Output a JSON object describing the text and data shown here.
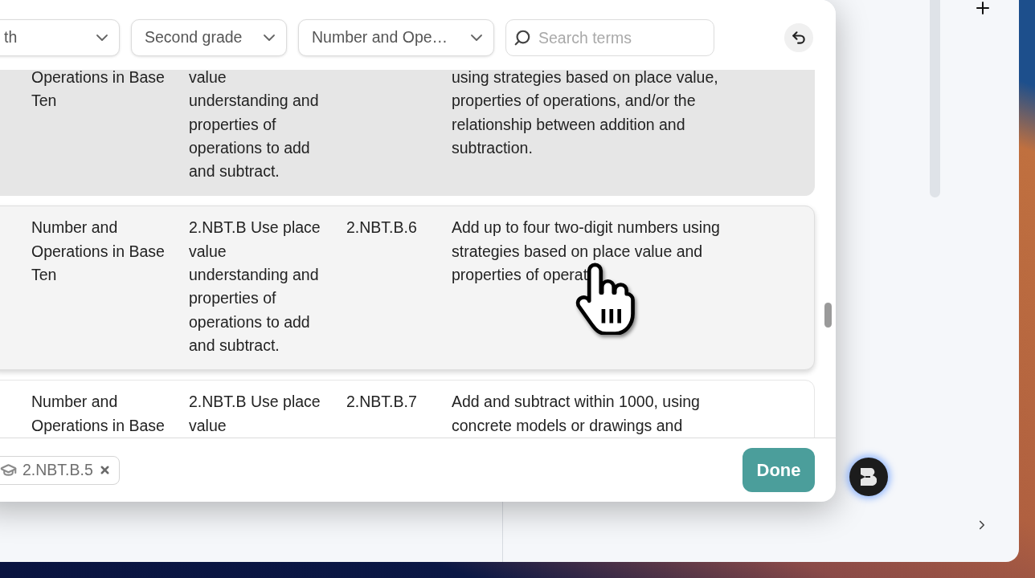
{
  "filters": [
    {
      "value": "th"
    },
    {
      "value": "Second grade"
    },
    {
      "value": "Number and Ope…"
    }
  ],
  "search": {
    "placeholder": "Search terms"
  },
  "table": {
    "rows": [
      {
        "selected": true,
        "hovered": false,
        "column_1": "Operations in Base Ten",
        "column_2": "value understanding and properties of operations to add and subtract.",
        "column_4": "using strategies based on place value, properties of operations, and/or the relationship between addition and subtraction."
      },
      {
        "selected": false,
        "hovered": true,
        "column_1": "Number and Operations in Base Ten",
        "column_2": "2.NBT.B Use place value understanding and properties of operations to add and subtract.",
        "column_3": "2.NBT.B.6",
        "column_4": "Add up to four two-digit numbers using strategies based on place value and properties of operat"
      },
      {
        "selected": false,
        "hovered": false,
        "column_1": "Number and Operations in Base",
        "column_2": "2.NBT.B Use place value",
        "column_3": "2.NBT.B.7",
        "column_4": "Add and subtract within 1000, using concrete models or drawings and"
      }
    ]
  },
  "selected_standards": [
    {
      "label": "2.NBT.B.5"
    }
  ],
  "done_button": {
    "label": "Done"
  }
}
